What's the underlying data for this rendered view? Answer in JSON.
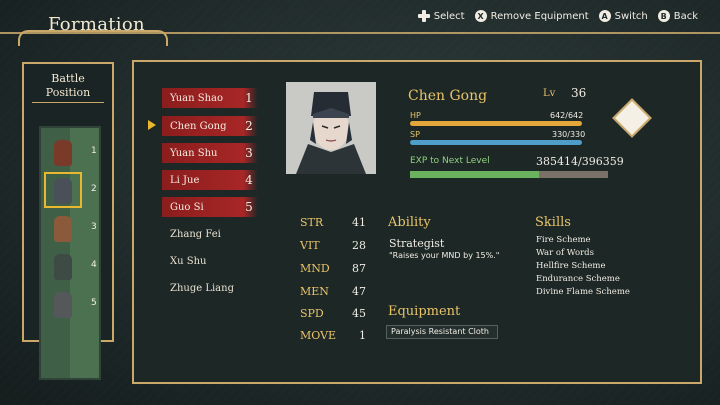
{
  "header": {
    "title": "Formation"
  },
  "controls": [
    {
      "button": "dpad",
      "label": "Select"
    },
    {
      "button": "X",
      "label": "Remove Equipment"
    },
    {
      "button": "A",
      "label": "Switch"
    },
    {
      "button": "B",
      "label": "Back"
    }
  ],
  "battle_position": {
    "title_line1": "Battle",
    "title_line2": "Position",
    "slots": [
      "1",
      "2",
      "3",
      "4",
      "5"
    ],
    "selected_slot": "2"
  },
  "roster": [
    {
      "name": "Yuan Shao",
      "slot": "1",
      "in_formation": true
    },
    {
      "name": "Chen Gong",
      "slot": "2",
      "in_formation": true
    },
    {
      "name": "Yuan Shu",
      "slot": "3",
      "in_formation": true
    },
    {
      "name": "Li Jue",
      "slot": "4",
      "in_formation": true
    },
    {
      "name": "Guo Si",
      "slot": "5",
      "in_formation": true
    },
    {
      "name": "Zhang Fei",
      "slot": "",
      "in_formation": false
    },
    {
      "name": "Xu Shu",
      "slot": "",
      "in_formation": false
    },
    {
      "name": "Zhuge Liang",
      "slot": "",
      "in_formation": false
    }
  ],
  "character": {
    "name": "Chen Gong",
    "lv_label": "Lv",
    "level": "36",
    "hp_label": "HP",
    "hp": "642/642",
    "hp_fraction": 1.0,
    "sp_label": "SP",
    "sp": "330/330",
    "sp_fraction": 1.0,
    "exp_label": "EXP to Next Level",
    "exp": "385414/396359",
    "exp_fraction": 0.65
  },
  "stats": [
    {
      "label": "STR",
      "value": "41"
    },
    {
      "label": "VIT",
      "value": "28"
    },
    {
      "label": "MND",
      "value": "87"
    },
    {
      "label": "MEN",
      "value": "47"
    },
    {
      "label": "SPD",
      "value": "45"
    },
    {
      "label": "MOVE",
      "value": "1"
    }
  ],
  "ability": {
    "heading": "Ability",
    "name": "Strategist",
    "description": "\"Raises your MND by 15%.\""
  },
  "equipment": {
    "heading": "Equipment",
    "items": [
      "Paralysis Resistant Cloth"
    ]
  },
  "skills": {
    "heading": "Skills",
    "items": [
      "Fire Scheme",
      "War of Words",
      "Hellfire Scheme",
      "Endurance Scheme",
      "Divine Flame Scheme"
    ]
  },
  "colors": {
    "accent_gold": "#c9a86a",
    "highlight": "#e8b830",
    "active_row": "#a82626",
    "hp_bar": "#e2a63a",
    "sp_bar": "#4e9ec9",
    "exp_bar": "#6bb25f"
  }
}
